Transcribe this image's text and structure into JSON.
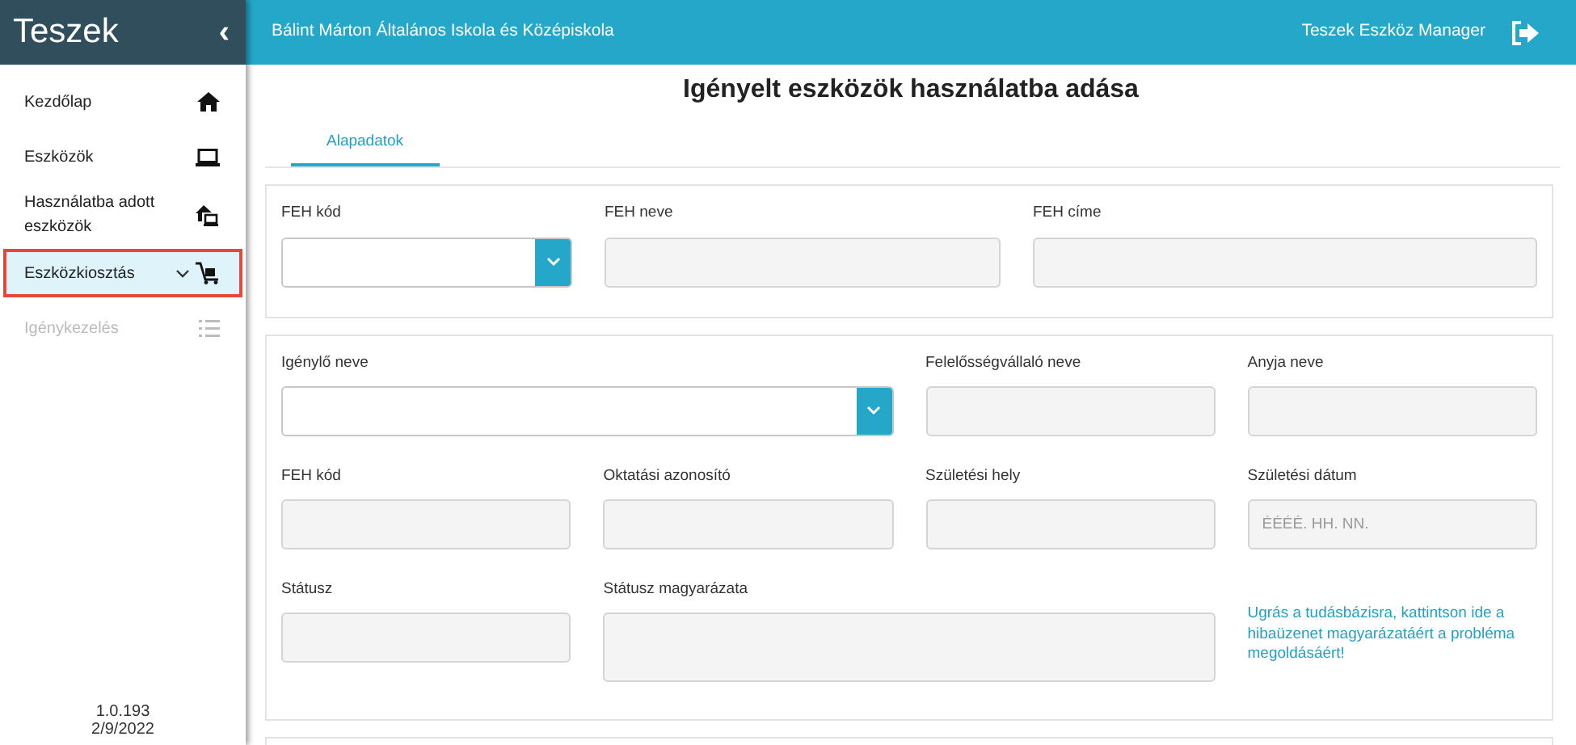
{
  "sidebar": {
    "brand": "Teszek",
    "collapse_glyph": "‹",
    "items": [
      {
        "label": "Kezdőlap",
        "selected": false,
        "disabled": false,
        "expandable": false
      },
      {
        "label": "Eszközök",
        "selected": false,
        "disabled": false,
        "expandable": false
      },
      {
        "label": "Használatba adott eszközök",
        "selected": false,
        "disabled": false,
        "expandable": false
      },
      {
        "label": "Eszközkiosztás",
        "selected": true,
        "disabled": false,
        "expandable": true
      },
      {
        "label": "Igénykezelés",
        "selected": false,
        "disabled": true,
        "expandable": false
      }
    ],
    "version": "1.0.193",
    "date": "2/9/2022"
  },
  "topbar": {
    "school": "Bálint Márton Általános Iskola és Középiskola",
    "user": "Teszek Eszköz Manager"
  },
  "page_title": "Igényelt eszközök használatba adása",
  "tabs": [
    {
      "label": "Alapadatok",
      "selected": true
    }
  ],
  "sections": [
    {
      "fields": [
        {
          "kind": "select",
          "label": "FEH kód"
        },
        {
          "kind": "input",
          "label": "FEH neve"
        },
        {
          "kind": "input",
          "label": "FEH címe"
        }
      ]
    },
    {
      "fields": [
        {
          "kind": "select",
          "label": "Igénylő neve"
        },
        {
          "kind": "input",
          "label": "Felelősségvállaló neve"
        },
        {
          "kind": "input",
          "label": "Anyja neve"
        },
        {
          "kind": "input",
          "label": "FEH kód"
        },
        {
          "kind": "input",
          "label": "Oktatási azonosító"
        },
        {
          "kind": "input",
          "label": "Születési hely"
        },
        {
          "kind": "input",
          "label": "Születési dátum",
          "placeholder": "ÉÉÉÉ. HH. NN."
        },
        {
          "kind": "input",
          "label": "Státusz"
        },
        {
          "kind": "textarea",
          "label": "Státusz magyarázata"
        },
        {
          "kind": "link",
          "label": "Ugrás a tudásbázisra, kattintson ide a hibaüzenet magyarázatáért a probléma megoldásáért!"
        }
      ]
    }
  ]
}
